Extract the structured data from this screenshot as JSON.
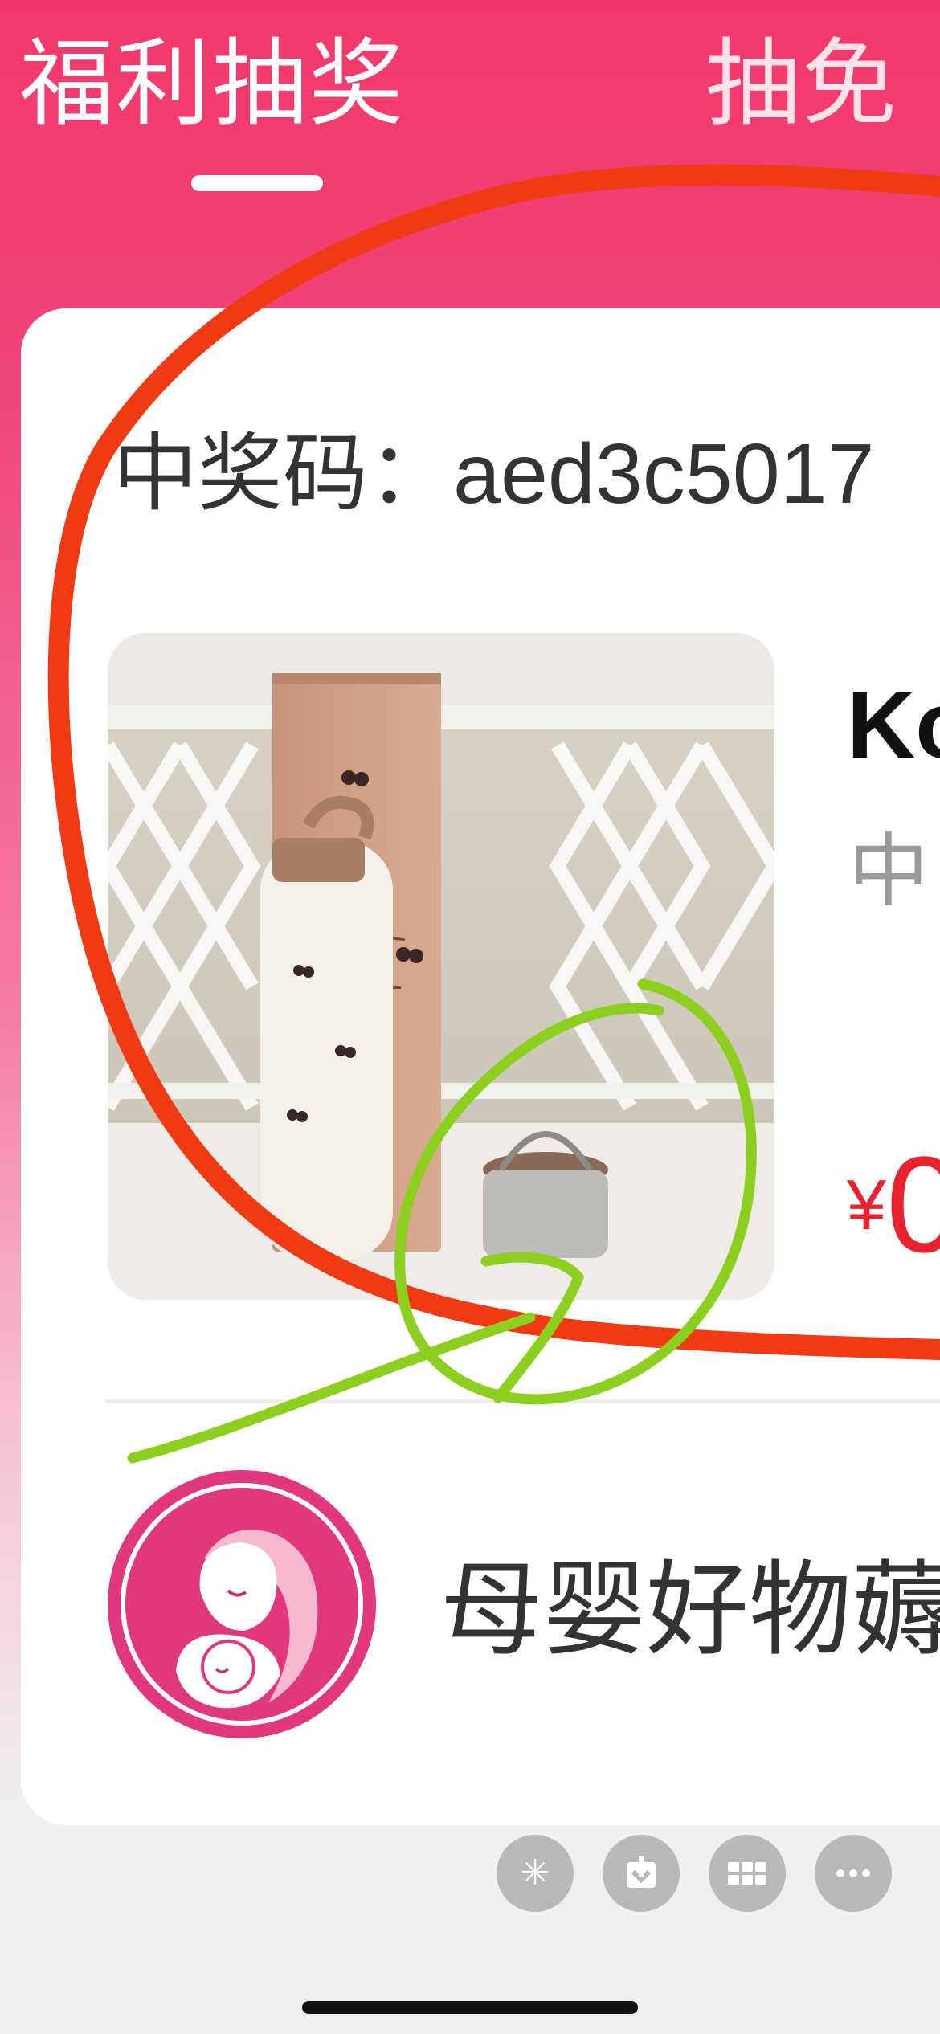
{
  "tabs": [
    {
      "label": "福利抽奖",
      "active": true
    },
    {
      "label": "抽免",
      "active": false
    }
  ],
  "card": {
    "prize_code_label": "中奖码：",
    "prize_code_value": "aed3c5017",
    "product_title": "Ko",
    "product_subtitle": "中",
    "price_currency": "¥",
    "price_value": "0",
    "shop_name": "母婴好物薅"
  },
  "toolbar": {
    "icons": [
      "sparkle-icon",
      "download-icon",
      "grid-icon",
      "more-icon"
    ]
  },
  "colors": {
    "brand_pink": "#f2386a",
    "price_red": "#e8222e",
    "avatar_pink": "#e0377f",
    "annotation_red": "#f03a14",
    "annotation_green": "#8ccf1e"
  }
}
